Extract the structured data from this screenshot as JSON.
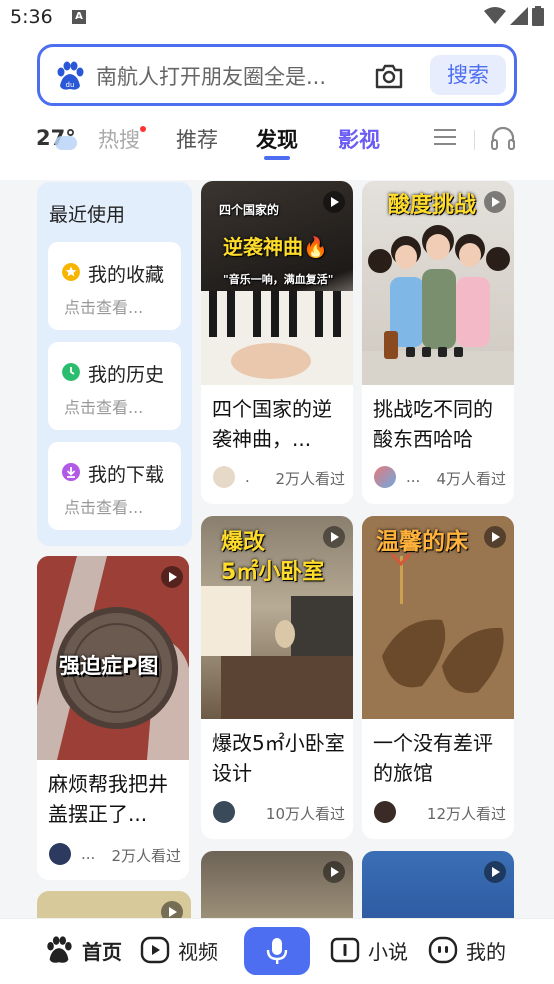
{
  "status_bar": {
    "time": "5:36",
    "notification_icon": "A"
  },
  "search": {
    "query": "南航人打开朋友圈全是...",
    "button_label": "搜索"
  },
  "tabs": {
    "temperature": "27°",
    "items": [
      "热搜",
      "推荐",
      "发现",
      "影视"
    ],
    "active": "发现"
  },
  "recent": {
    "title": "最近使用",
    "items": [
      {
        "label": "我的收藏",
        "sub": "点击查看...",
        "icon": "star-icon",
        "color": "#f7b500"
      },
      {
        "label": "我的历史",
        "sub": "点击查看...",
        "icon": "clock-icon",
        "color": "#2bbd6e"
      },
      {
        "label": "我的下载",
        "sub": "点击查看...",
        "icon": "download-icon",
        "color": "#b25ae6"
      }
    ]
  },
  "feed": {
    "cards": [
      {
        "title": "四个国家的逆袭神曲，...",
        "author": ".",
        "views": "2万人看过",
        "overlay": [
          "四个国家的",
          "逆袭神曲🔥",
          "\"音乐一响，满血复活\""
        ]
      },
      {
        "title": "挑战吃不同的酸东西哈哈",
        "author": "...",
        "views": "4万人看过",
        "overlay": [
          "酸度挑战"
        ]
      },
      {
        "title": "麻烦帮我把井盖摆正了...",
        "author": "...",
        "views": "2万人看过",
        "overlay": [
          "强迫症P图"
        ]
      },
      {
        "title": "爆改5㎡小卧室设计",
        "author": "",
        "views": "10万人看过",
        "overlay": [
          "爆改",
          "5㎡小卧室"
        ]
      },
      {
        "title": "一个没有差评的旅馆",
        "author": "",
        "views": "12万人看过",
        "overlay": [
          "温馨的床"
        ]
      }
    ]
  },
  "bottom_nav": {
    "home": "首页",
    "video": "视频",
    "novel": "小说",
    "mine": "我的"
  },
  "colors": {
    "accent": "#4e6ef2",
    "video_tab": "#6a5cf5"
  }
}
